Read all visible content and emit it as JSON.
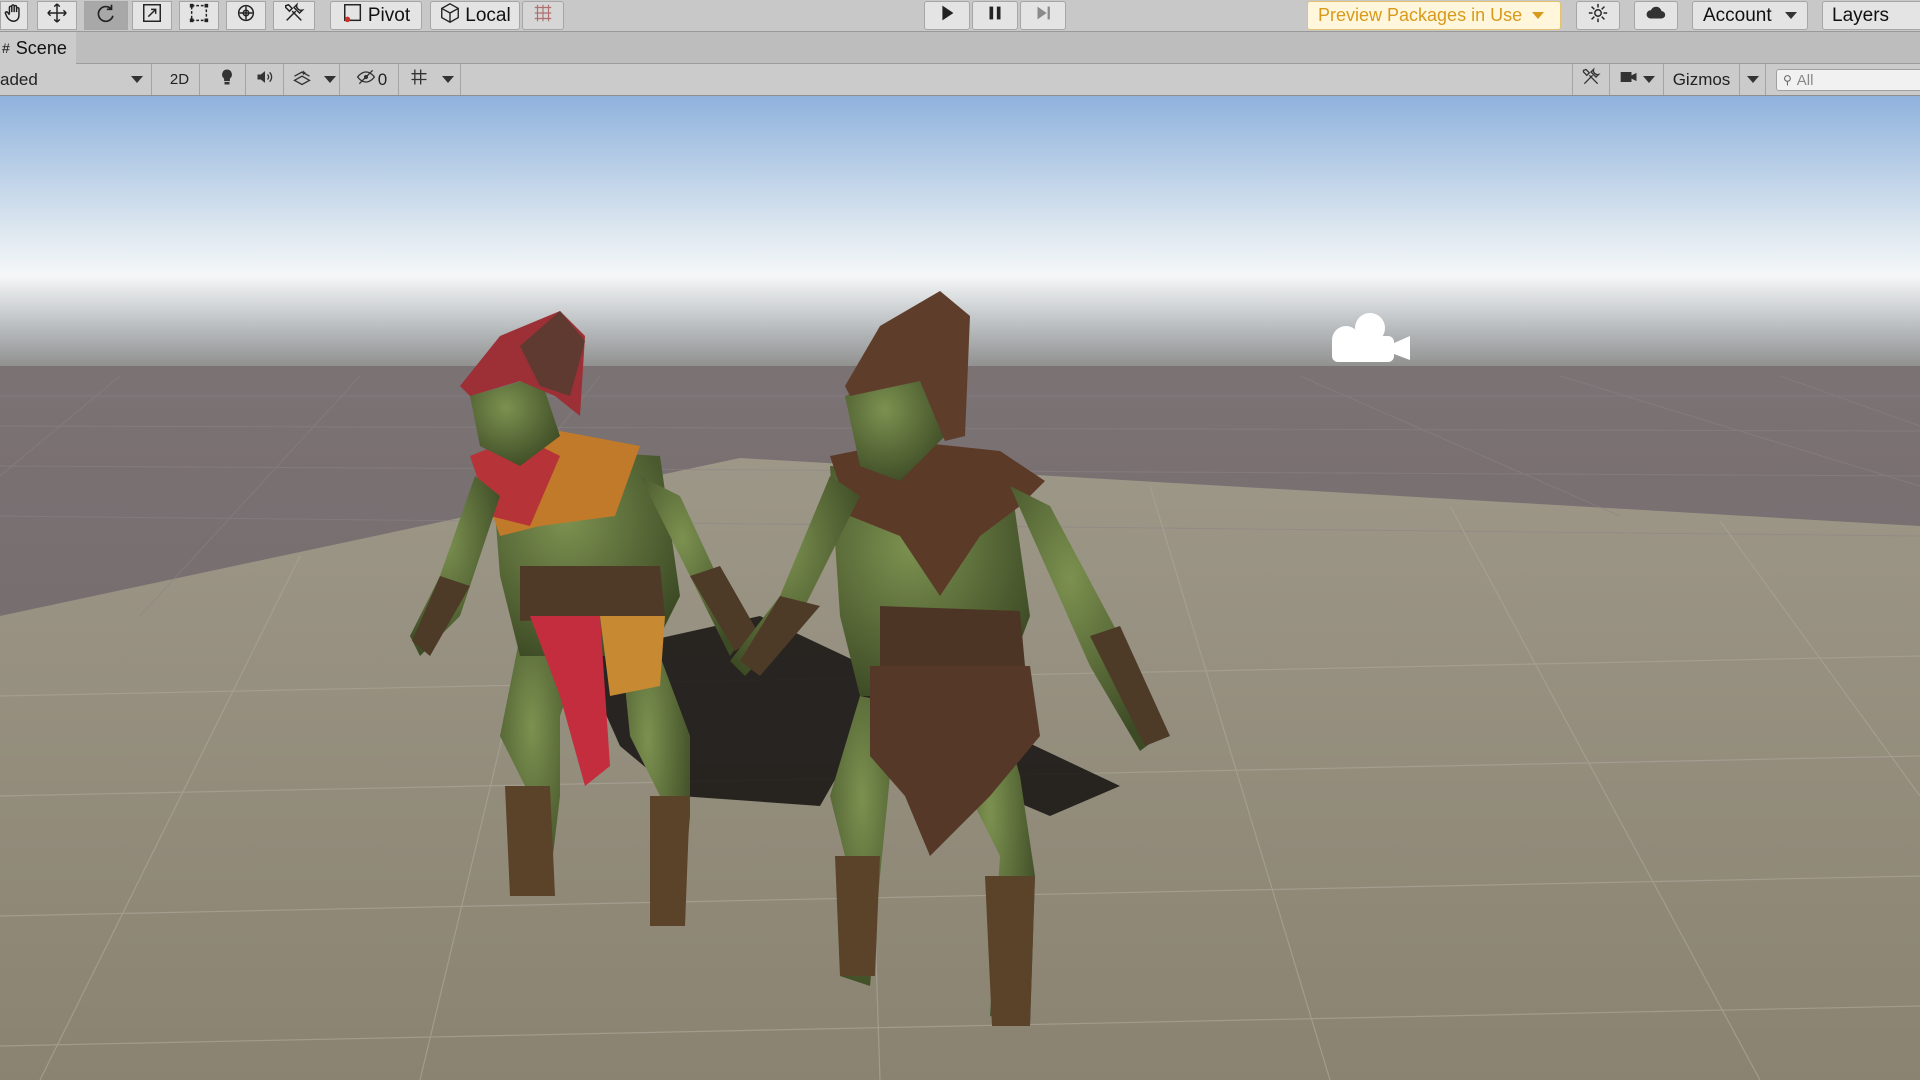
{
  "toolbar": {
    "pivot_label": "Pivot",
    "local_label": "Local",
    "play_icon": "play-icon",
    "pause_icon": "pause-icon",
    "step_icon": "step-icon",
    "preview_packages_label": "Preview Packages in Use",
    "account_label": "Account",
    "layers_label": "Layers",
    "accent_color": "#d89a1b"
  },
  "scene_tab": {
    "title": "Scene"
  },
  "scene_toolbar": {
    "draw_mode": "aded",
    "mode_2d_label": "2D",
    "hidden_count": "0",
    "gizmos_label": "Gizmos",
    "search_placeholder": "All"
  },
  "viewport": {
    "sky_top_color": "#8fb2dd",
    "horizon_color": "#f3f6f8",
    "ground_color": "#8a8273",
    "characters": [
      "goblin-left",
      "goblin-right"
    ]
  }
}
